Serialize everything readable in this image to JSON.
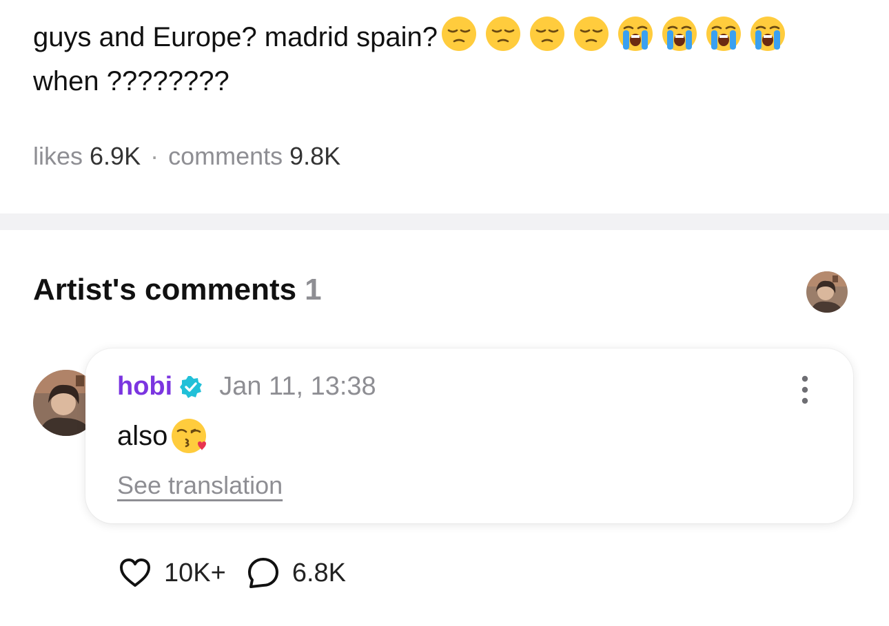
{
  "post": {
    "line1": "guys and Europe? madrid spain?",
    "line2": "when ????????",
    "emojis": [
      "pensive-face",
      "pensive-face",
      "pensive-face",
      "pensive-face",
      "loudly-crying-face",
      "loudly-crying-face",
      "loudly-crying-face",
      "loudly-crying-face"
    ]
  },
  "stats": {
    "likes_label": "likes",
    "likes_value": "6.9K",
    "separator": "·",
    "comments_label": "comments",
    "comments_value": "9.8K"
  },
  "artist_comments": {
    "title": "Artist's comments",
    "count": "1"
  },
  "comment": {
    "author": "hobi",
    "verified": true,
    "timestamp": "Jan 11, 13:38",
    "text": "also",
    "text_emoji": "face-blowing-a-kiss",
    "translate_label": "See translation",
    "likes": "10K+",
    "replies": "6.8K"
  },
  "colors": {
    "author": "#7b35e0",
    "verified_badge": "#21c0d8",
    "muted_text": "#8e8e93",
    "divider": "#f2f2f4"
  }
}
